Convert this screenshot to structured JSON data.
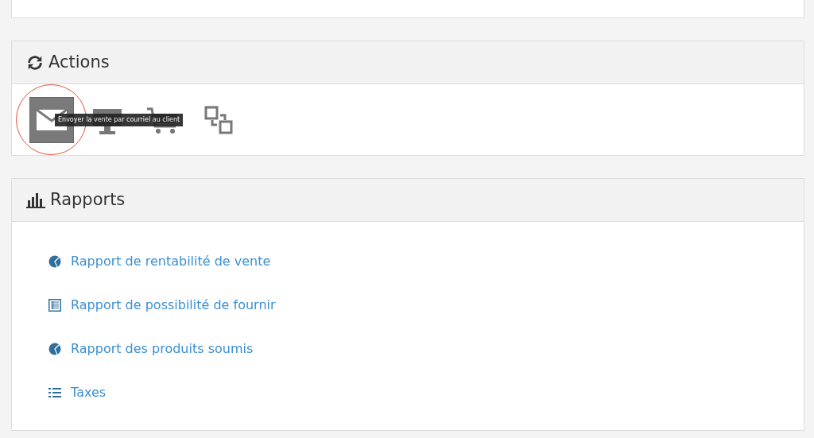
{
  "actions_panel": {
    "title": "Actions",
    "buttons": [
      {
        "kind": "mail",
        "selected": true
      },
      {
        "kind": "monitor",
        "selected": false
      },
      {
        "kind": "cart",
        "selected": false
      },
      {
        "kind": "transfer",
        "selected": false
      }
    ],
    "tooltip": "Envoyer la vente par courriel au client",
    "highlighted": true
  },
  "reports_panel": {
    "title": "Rapports",
    "links": [
      {
        "kind": "pie",
        "label": "Rapport de rentabilité de vente"
      },
      {
        "kind": "table",
        "label": "Rapport de possibilité de fournir"
      },
      {
        "kind": "pie",
        "label": "Rapport des produits soumis"
      },
      {
        "kind": "list",
        "label": "Taxes"
      }
    ]
  }
}
